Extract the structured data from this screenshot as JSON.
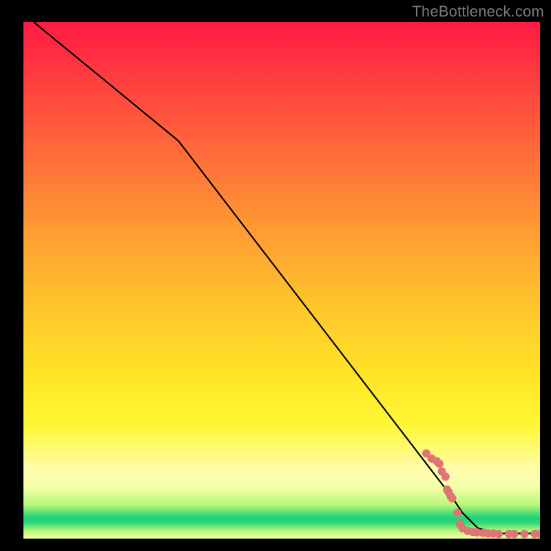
{
  "watermark": "TheBottleneck.com",
  "chart_data": {
    "type": "line",
    "title": "",
    "xlabel": "",
    "ylabel": "",
    "xlim": [
      0,
      100
    ],
    "ylim": [
      0,
      100
    ],
    "grid": false,
    "legend": "none",
    "curve": {
      "name": "bottleneck-curve",
      "color": "#000000",
      "points_xy": [
        [
          2,
          100
        ],
        [
          30,
          77
        ],
        [
          83,
          8
        ],
        [
          85,
          5
        ],
        [
          88,
          2
        ],
        [
          92,
          1
        ],
        [
          100,
          1
        ]
      ]
    },
    "scatter": {
      "name": "data-points",
      "color": "#e07474",
      "radius_px": 6,
      "points_xy": [
        [
          78,
          16.5
        ],
        [
          79,
          15.5
        ],
        [
          80,
          15
        ],
        [
          80.5,
          14.5
        ],
        [
          81,
          13
        ],
        [
          81.7,
          12
        ],
        [
          82,
          9.5
        ],
        [
          82.3,
          9
        ],
        [
          82.7,
          8.2
        ],
        [
          83,
          7.8
        ],
        [
          84,
          5
        ],
        [
          84.5,
          2.8
        ],
        [
          85,
          2
        ],
        [
          86,
          1.5
        ],
        [
          87,
          1.3
        ],
        [
          87.8,
          1.2
        ],
        [
          89,
          1.1
        ],
        [
          90,
          1
        ],
        [
          91,
          1
        ],
        [
          92,
          0.9
        ],
        [
          94,
          0.9
        ],
        [
          95,
          0.9
        ],
        [
          97,
          0.9
        ],
        [
          99,
          0.9
        ],
        [
          100,
          0.9
        ]
      ]
    },
    "background_gradient_stops": [
      {
        "pos": 0,
        "color": "#ff1a45"
      },
      {
        "pos": 40,
        "color": "#ff9a33"
      },
      {
        "pos": 78,
        "color": "#fff735"
      },
      {
        "pos": 90,
        "color": "#f4ffa8"
      },
      {
        "pos": 96,
        "color": "#1fd07a"
      },
      {
        "pos": 100,
        "color": "#f4ffa8"
      }
    ]
  }
}
